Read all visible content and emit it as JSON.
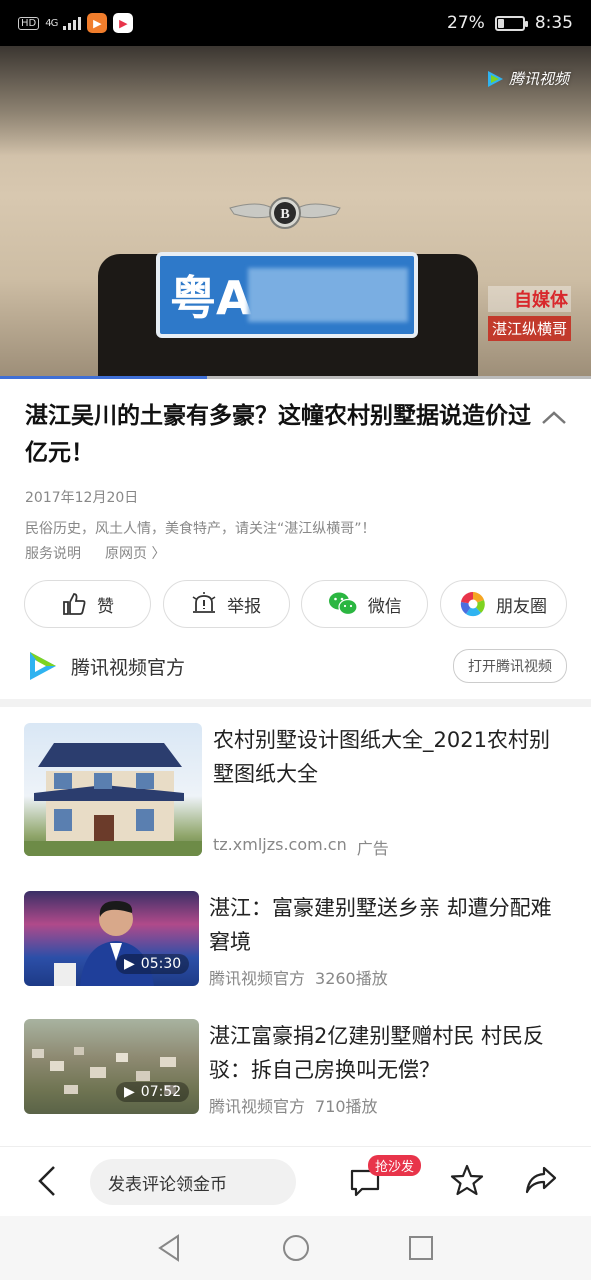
{
  "status_bar": {
    "signal": "4G",
    "hd": "HD",
    "battery_percent": "27%",
    "battery_level": 0.27,
    "time": "8:35"
  },
  "video": {
    "logo_text": "腾讯视频",
    "plate_prefix": "粤A·",
    "watermark_line1": "自媒体",
    "watermark_line2": "湛江纵横哥",
    "progress_fraction": 0.35
  },
  "article": {
    "title": "湛江吴川的土豪有多豪？这幢农村别墅据说造价过亿元！",
    "date": "2017年12月20日",
    "description": "民俗历史，风土人情，美食特产，请关注“湛江纵横哥”！",
    "service_link": "服务说明",
    "source_link": "原网页 〉"
  },
  "actions": {
    "like": "赞",
    "report": "举报",
    "wechat": "微信",
    "moments": "朋友圈"
  },
  "source": {
    "name": "腾讯视频官方",
    "open_button": "打开腾讯视频"
  },
  "recommendations": [
    {
      "title": "农村别墅设计图纸大全_2021农村别墅图纸大全",
      "domain": "tz.xmljzs.com.cn",
      "tag": "广告"
    },
    {
      "title": "湛江：富豪建别墅送乡亲 却遭分配难窘境",
      "source": "腾讯视频官方",
      "plays": "3260播放",
      "duration": "05:30"
    },
    {
      "title": "湛江富豪捐2亿建别墅赠村民 村民反驳：拆自己房换叫无偿？",
      "source": "腾讯视频官方",
      "plays": "710播放",
      "duration": "07:52"
    }
  ],
  "bottom_bar": {
    "comment_placeholder": "发表评论领金币",
    "sofa_badge": "抢沙发"
  },
  "colors": {
    "accent_blue": "#3f6fd6",
    "badge_red": "#e8344a",
    "wechat_green": "#2bb641"
  }
}
